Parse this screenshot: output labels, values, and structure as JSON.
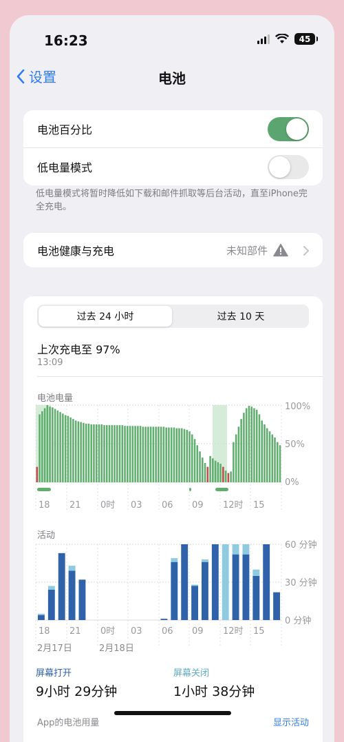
{
  "status_bar": {
    "time": "16:23",
    "battery": "45"
  },
  "nav": {
    "back_label": "设置",
    "title": "电池"
  },
  "settings": {
    "battery_percentage": {
      "label": "电池百分比",
      "on": true
    },
    "low_power_mode": {
      "label": "低电量模式",
      "on": false
    },
    "footnote": "低电量模式将暂时降低如下载和邮件抓取等后台活动，直至iPhone完全充电。"
  },
  "health": {
    "label": "电池健康与充电",
    "value": "未知部件"
  },
  "usage": {
    "tabs": [
      "过去 24 小时",
      "过去 10 天"
    ],
    "selected_tab": 0,
    "last_charge": {
      "label": "上次充电至 97%",
      "time": "13:09"
    },
    "battery_level_label": "电池电量",
    "activity_label": "活动",
    "dates": [
      "2月17日",
      "2月18日"
    ],
    "screen_on": {
      "label": "屏幕打开",
      "value": "9小时 29分钟"
    },
    "screen_off": {
      "label": "屏幕关闭",
      "value": "1小时 38分钟"
    },
    "app_usage_label": "App的电池用量",
    "show_activity": "显示活动",
    "colors": {
      "green": "#5fae6e",
      "red": "#c24b4b",
      "blue": "#2f62a8",
      "lightblue": "#8ecbe1",
      "charging": "#d4ecd8"
    }
  },
  "chart_data": [
    {
      "type": "bar",
      "title": "电池电量",
      "x_tick_labels": [
        "18",
        "21",
        "0时",
        "03",
        "06",
        "09",
        "12时",
        "15"
      ],
      "y_tick_labels": [
        "100%",
        "50%",
        "0%"
      ],
      "ylim": [
        0,
        100
      ],
      "values": [
        20,
        88,
        92,
        96,
        100,
        98,
        97,
        95,
        93,
        91,
        89,
        87,
        86,
        84,
        82,
        80,
        79,
        78,
        77,
        76,
        76,
        75,
        75,
        75,
        75,
        75,
        74,
        74,
        74,
        74,
        74,
        74,
        74,
        74,
        73,
        73,
        73,
        73,
        73,
        73,
        73,
        72,
        72,
        72,
        72,
        72,
        72,
        72,
        72,
        72,
        71,
        71,
        71,
        71,
        70,
        70,
        70,
        69,
        68,
        66,
        62,
        56,
        48,
        40,
        32,
        25,
        20,
        34,
        31,
        28,
        26,
        24,
        20,
        15,
        12,
        14,
        52,
        62,
        72,
        82,
        90,
        96,
        99,
        98,
        96,
        94,
        88,
        80,
        75,
        70,
        66,
        62,
        58,
        52,
        48
      ],
      "colors": [
        "red",
        "green",
        "green",
        "green",
        "green",
        "green",
        "green",
        "green",
        "green",
        "green",
        "green",
        "green",
        "green",
        "green",
        "green",
        "green",
        "green",
        "green",
        "green",
        "green",
        "green",
        "green",
        "green",
        "green",
        "green",
        "green",
        "green",
        "green",
        "green",
        "green",
        "green",
        "green",
        "green",
        "green",
        "green",
        "green",
        "green",
        "green",
        "green",
        "green",
        "green",
        "green",
        "green",
        "green",
        "green",
        "green",
        "green",
        "green",
        "green",
        "green",
        "green",
        "green",
        "green",
        "green",
        "green",
        "green",
        "green",
        "green",
        "green",
        "green",
        "green",
        "green",
        "green",
        "green",
        "green",
        "green",
        "red",
        "green",
        "green",
        "green",
        "green",
        "green",
        "red",
        "green",
        "red",
        "green",
        "green",
        "green",
        "green",
        "green",
        "green",
        "green",
        "green",
        "green",
        "green",
        "green",
        "green",
        "green",
        "green",
        "green",
        "green",
        "green",
        "green",
        "green",
        "green"
      ]
    },
    {
      "type": "bar",
      "title": "活动",
      "x_tick_labels": [
        "18",
        "21",
        "0时",
        "03",
        "06",
        "09",
        "12时",
        "15"
      ],
      "y_tick_labels": [
        "60 分钟",
        "30 分钟",
        "0 分钟"
      ],
      "ylim": [
        0,
        60
      ],
      "series": [
        {
          "name": "屏幕打开",
          "values": [
            4,
            24,
            53,
            39,
            32,
            0,
            0,
            0,
            0,
            0,
            0,
            0,
            1,
            46,
            60,
            27,
            46,
            60,
            0,
            52,
            52,
            35,
            60,
            22
          ]
        },
        {
          "name": "屏幕关闭",
          "values": [
            1,
            3,
            0,
            4,
            0,
            0,
            0,
            0,
            0,
            0,
            0,
            0,
            0,
            3,
            0,
            1,
            2,
            0,
            60,
            8,
            8,
            5,
            0,
            0
          ]
        }
      ]
    }
  ]
}
